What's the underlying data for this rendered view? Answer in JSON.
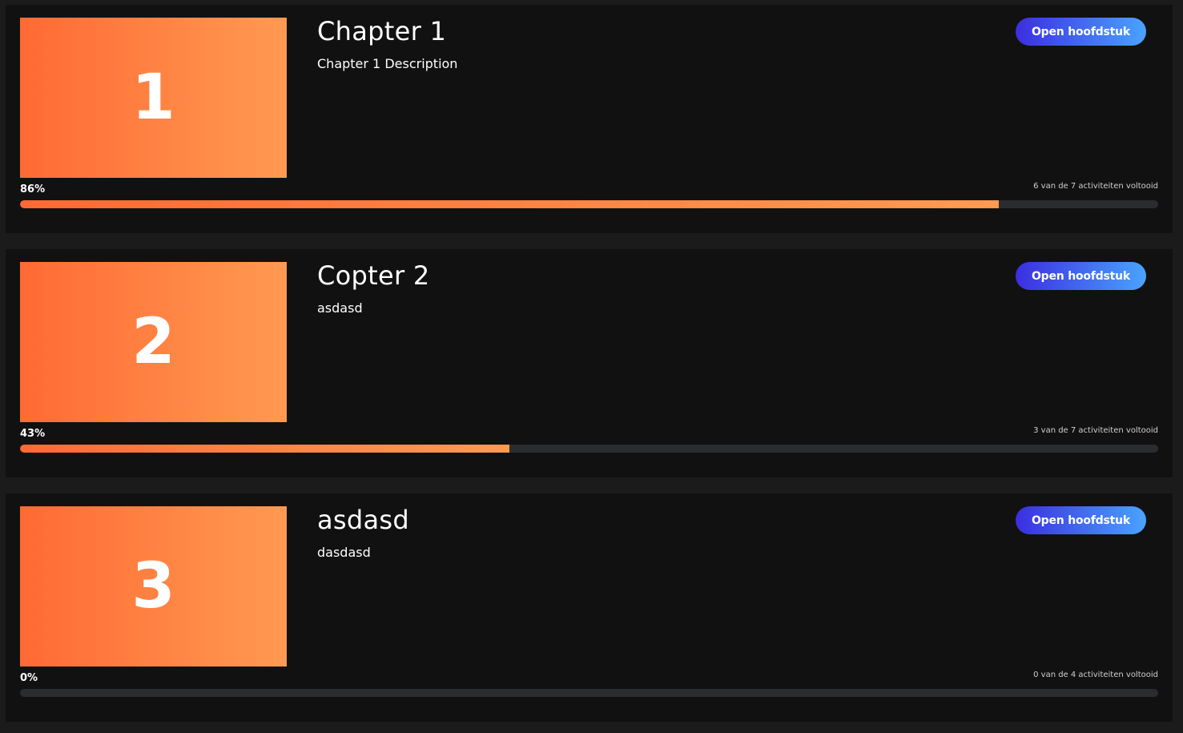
{
  "chapters": [
    {
      "number": "1",
      "title": "Chapter 1",
      "description": "Chapter 1 Description",
      "button_label": "Open hoofdstuk",
      "percent_label": "86%",
      "progress": 0.86,
      "activities_label": "6 van de 7 activiteiten voltooid"
    },
    {
      "number": "2",
      "title": "Copter 2",
      "description": "asdasd",
      "button_label": "Open hoofdstuk",
      "percent_label": "43%",
      "progress": 0.43,
      "activities_label": "3 van de 7 activiteiten voltooid"
    },
    {
      "number": "3",
      "title": "asdasd",
      "description": "dasdasd",
      "button_label": "Open hoofdstuk",
      "percent_label": "0%",
      "progress": 0,
      "activities_label": "0 van de 4 activiteiten voltooid"
    }
  ],
  "colors": {
    "accent_orange_start": "#ff6a33",
    "accent_orange_end": "#ff9a52",
    "button_blue_start": "#3b2ee0",
    "button_blue_end": "#4aa3ff",
    "card_background": "#111111",
    "page_background": "#1b1b1b",
    "track": "#2a2c30"
  }
}
